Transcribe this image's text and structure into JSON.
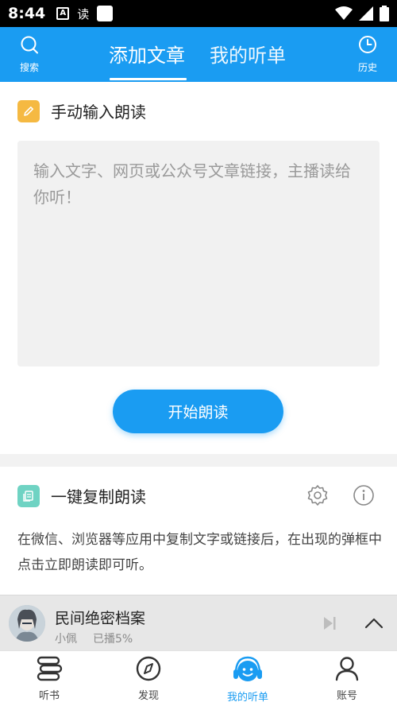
{
  "status_bar": {
    "time": "8:44",
    "a_glyph": "A",
    "du_glyph": "读"
  },
  "header": {
    "search_label": "搜索",
    "history_label": "历史",
    "tabs": [
      {
        "label": "添加文章",
        "active": true
      },
      {
        "label": "我的听单",
        "active": false
      }
    ]
  },
  "manual": {
    "title": "手动输入朗读",
    "placeholder": "输入文字、网页或公众号文章链接，主播读给你听！",
    "start_button": "开始朗读"
  },
  "copy": {
    "title": "一键复制朗读",
    "description": "在微信、浏览器等应用中复制文字或链接后，在出现的弹框中点击立即朗读即可听。"
  },
  "player": {
    "title": "民间绝密档案",
    "narrator": "小佩",
    "progress_text": "已播5%"
  },
  "bottom_nav": [
    {
      "label": "听书",
      "icon": "books-icon",
      "active": false
    },
    {
      "label": "发现",
      "icon": "compass-icon",
      "active": false
    },
    {
      "label": "我的听单",
      "icon": "headphones-icon",
      "active": true
    },
    {
      "label": "账号",
      "icon": "user-icon",
      "active": false
    }
  ],
  "colors": {
    "primary": "#1a9cf2",
    "pencil_icon": "#f5b942",
    "copy_icon": "#6fd3c3"
  }
}
